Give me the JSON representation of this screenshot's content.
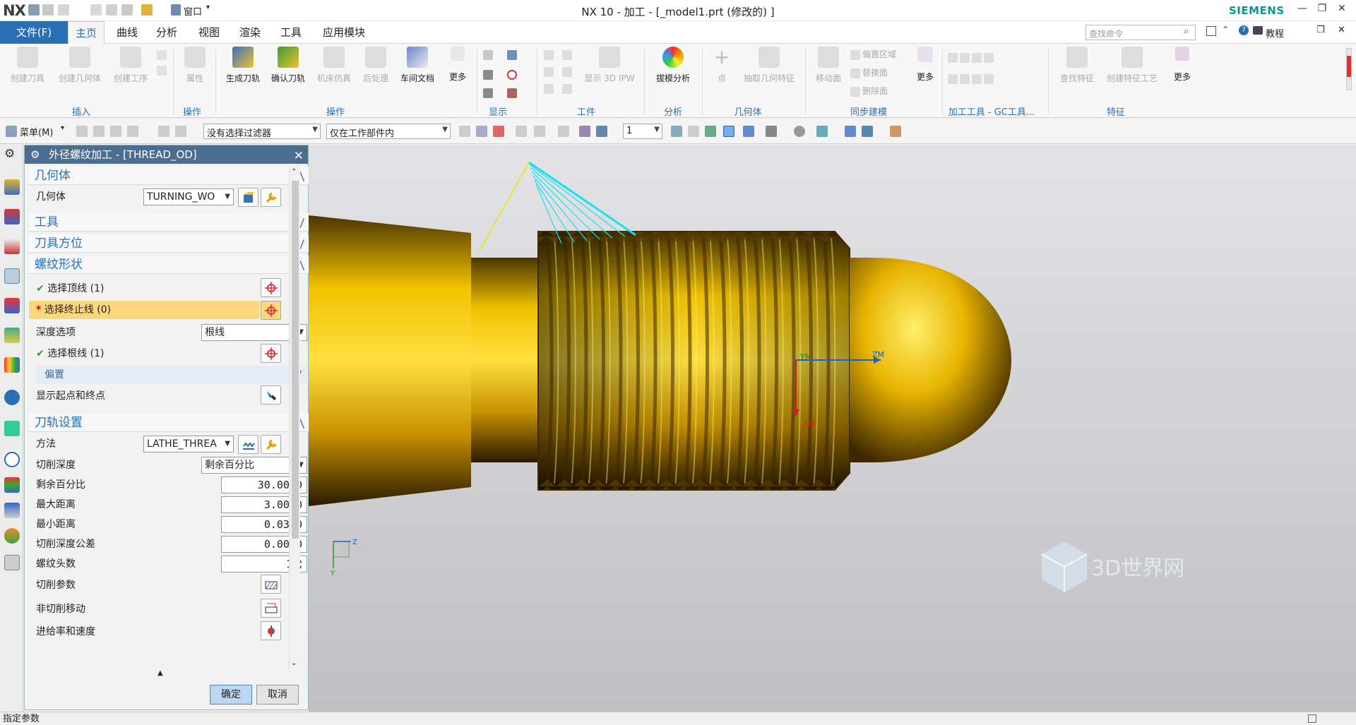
{
  "app": {
    "logo": "NX",
    "title": "NX 10 - 加工 - [_model1.prt  (修改的)  ]",
    "brand": "SIEMENS",
    "window_menu": "窗口"
  },
  "tabs": [
    "主页",
    "曲线",
    "分析",
    "视图",
    "渲染",
    "工具",
    "应用模块"
  ],
  "file_tab": "文件(F)",
  "active_tab": "主页",
  "search": {
    "placeholder": "查找命令"
  },
  "tutorial": "教程",
  "ribbon": {
    "insert": {
      "create_tool": "创建刀具",
      "create_geometry": "创建几何体",
      "create_operation": "创建工序",
      "group": "插入"
    },
    "ops_group": {
      "properties": "属性",
      "group": "操作"
    },
    "operation": {
      "generate": "生成刀轨",
      "verify": "确认刀轨",
      "simulate": "机床仿真",
      "postprocess": "后处理",
      "shop_doc": "车间文档",
      "more": "更多",
      "group": "操作"
    },
    "display": {
      "group": "显示"
    },
    "workpiece": {
      "show_ipw": "显示 3D IPW",
      "group": "工件"
    },
    "analysis": {
      "draft": "拔模分析",
      "group": "分析"
    },
    "geometry": {
      "point": "点",
      "extract": "抽取几何特征",
      "group": "几何体"
    },
    "sync": {
      "move_face": "移动面",
      "offset_region": "偏置区域",
      "replace_face": "替换面",
      "delete_face": "删除面",
      "more": "更多",
      "group": "同步建模"
    },
    "gc": {
      "group": "加工工具 - GC工具..."
    },
    "feature": {
      "find": "查找特征",
      "create_feature_process": "创建特征工艺",
      "more": "更多",
      "group": "特征"
    }
  },
  "toolbar2": {
    "menu": "菜单(M)",
    "filter": "没有选择过滤器",
    "scope": "仅在工作部件内",
    "layer": "1"
  },
  "dialog": {
    "title": "外径螺纹加工 - [THREAD_OD]",
    "geometry_section": "几何体",
    "geometry_label": "几何体",
    "geometry_value": "TURNING_WO",
    "tool_section": "工具",
    "tool_axis_section": "刀具方位",
    "thread_section": "螺纹形状",
    "select_top": "选择顶线 (1)",
    "select_end": "选择终止线 (0)",
    "depth_option_label": "深度选项",
    "depth_option_value": "根线",
    "select_root": "选择根线 (1)",
    "offset": "偏置",
    "show_start_end": "显示起点和终点",
    "path_section": "刀轨设置",
    "method_label": "方法",
    "method_value": "LATHE_THREA",
    "cut_depth_label": "切削深度",
    "cut_depth_value": "剩余百分比",
    "remaining_pct_label": "剩余百分比",
    "remaining_pct_value": "30.0000",
    "max_dist_label": "最大距离",
    "max_dist_value": "3.0000",
    "min_dist_label": "最小距离",
    "min_dist_value": "0.0300",
    "depth_tol_label": "切削深度公差",
    "depth_tol_value": "0.0000",
    "thread_heads_label": "螺纹头数",
    "thread_heads_value": "1",
    "cut_params": "切削参数",
    "non_cut_moves": "非切削移动",
    "feeds_speeds": "进给率和速度",
    "ok": "确定",
    "cancel": "取消"
  },
  "viewport": {
    "ym": "YM",
    "zm": "ZM",
    "xm": "XM",
    "tri_z": "Z",
    "tri_y": "Y",
    "watermark": "3D世界网"
  },
  "status": "指定参数",
  "colors": {
    "accent": "#2a6fb6",
    "title_bg": "#4a6e90",
    "highlight": "#fcd77c",
    "gold": "#c99a00",
    "toolpath": "#18e0f0",
    "brand": "#009999"
  }
}
